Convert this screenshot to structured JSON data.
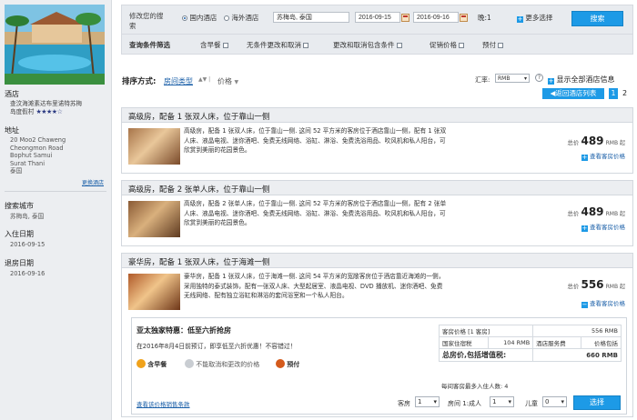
{
  "sidebar": {
    "hotel_section_label": "酒店",
    "hotel_name_line1": "查汶海滩素达布里诺特苏梅",
    "hotel_name_line2": "岛度假村",
    "stars": "★★★★☆",
    "address_label": "地址",
    "address_lines": [
      "20 Moo2 Chaweng",
      "Cheongmon Road",
      "Bophut Samui",
      "Surat Thani",
      "泰国"
    ],
    "change_hotel": "更换酒店",
    "search_city_label": "搜索城市",
    "search_city_value": "苏梅岛, 泰国",
    "checkin_label": "入住日期",
    "checkin_value": "2016-09-15",
    "checkout_label": "退房日期",
    "checkout_value": "2016-09-16"
  },
  "search": {
    "modify_label_1": "修改您的搜",
    "modify_label_2": "索",
    "domestic_label": "国内酒店",
    "overseas_label": "海外酒店",
    "destination_value": "苏梅岛, 泰国",
    "checkin_value": "2016-09-15",
    "checkout_value": "2016-09-16",
    "nights_label": "晚:1",
    "more_options": "更多选择",
    "search_button": "搜索",
    "filter_label": "查询条件筛选",
    "filters": [
      "含早餐",
      "无条件更改和取消",
      "更改和取消包含条件",
      "促销价格",
      "预付"
    ]
  },
  "sort": {
    "label": "排序方式:",
    "room_type": "房间类型",
    "price": "价格",
    "currency_label": "汇率:",
    "currency_value": "RMB",
    "help": "?",
    "show_all": "显示全部酒店信息",
    "back_to_list": "返回酒店列表",
    "pages": [
      "1",
      "2"
    ]
  },
  "rooms": [
    {
      "title": "高级房，配备 1 张双人床，位于靠山一侧",
      "desc": [
        "高级房，配备 1 张双人床，位于靠山一侧. 这间 52 平方米的客房位于酒店靠山一侧，配有 1 张双",
        "人床、液晶电视、迷你酒吧、免费无线网络、浴缸、淋浴、免费洗浴用品、吹风机和私人阳台，可",
        "欣赏到美丽的花园景色。"
      ],
      "price_prefix": "总价",
      "price": "489",
      "price_unit": "RMB 起",
      "view_price": "查看客房价格"
    },
    {
      "title": "高级房，配备 2 张单人床，位于靠山一侧",
      "desc": [
        "高级房，配备 2 张单人床，位于靠山一侧. 这间 52 平方米的客房位于酒店靠山一侧，配有 2 张单",
        "人床、液晶电视、迷你酒吧、免费无线网络、浴缸、淋浴、免费洗浴用品、吹风机和私人阳台，可",
        "欣赏到美丽的花园景色。"
      ],
      "price_prefix": "总价",
      "price": "489",
      "price_unit": "RMB 起",
      "view_price": "查看客房价格"
    },
    {
      "title": "豪华房，配备 1 张双人床，位于海滩一侧",
      "desc": [
        "豪华房，配备 1 张双人床，位于海滩一侧. 这间 54 平方米的宽敞客房位于酒店靠近海滩的一侧，",
        "采用独特的泰式装饰，配有一张双人床、大型起居室、液晶电视、DVD 播放机、迷你酒吧、免费",
        "无线网络、配有独立浴缸和淋浴的套间浴室和一个私人阳台。"
      ],
      "price_prefix": "总价",
      "price": "556",
      "price_unit": "RMB 起",
      "view_price": "查看客房价格"
    }
  ],
  "deal": {
    "title": "亚太独家特惠：低至六折抢房",
    "subtitle": "在2016年8月4日前预订，即享低至六折优惠！不容错过！",
    "features": [
      "含早餐",
      "不能取消和更改的价格",
      "预付"
    ],
    "rate_link": "查看该价格销售条款",
    "table": {
      "room_price_label": "客房价格 [1 客房]",
      "room_price_value": "556 RMB",
      "tax_label": "国家住宿税",
      "tax_value": "104 RMB",
      "service_label": "酒店服务费",
      "service_value": "价格包括",
      "total_label": "总房价,包括增值税:",
      "total_value": "660 RMB"
    },
    "max_guests": "每间客房最多入住人数: 4",
    "rooms_label": "客房",
    "rooms_value": "1",
    "room1_label": "房间 1:成人",
    "adults_value": "1",
    "children_label": "儿童",
    "children_value": "0",
    "select_button": "选择"
  }
}
